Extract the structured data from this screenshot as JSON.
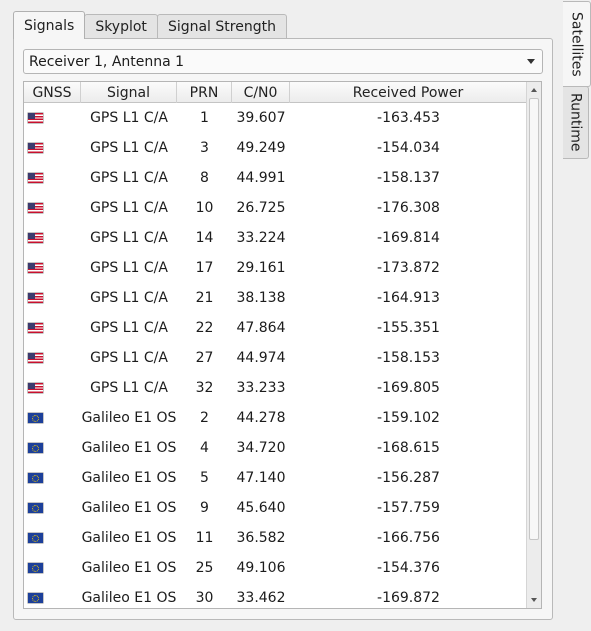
{
  "tabs": [
    "Signals",
    "Skyplot",
    "Signal Strength"
  ],
  "side_tabs": [
    "Satellites",
    "Runtime"
  ],
  "receiver_select": {
    "value": "Receiver 1, Antenna 1"
  },
  "table": {
    "columns": [
      "GNSS",
      "Signal",
      "PRN",
      "C/N0",
      "Received Power"
    ],
    "rows": [
      {
        "gnss": "us-flag-icon",
        "signal": "GPS L1 C/A",
        "prn": "1",
        "cn0": "39.607",
        "power": "-163.453"
      },
      {
        "gnss": "us-flag-icon",
        "signal": "GPS L1 C/A",
        "prn": "3",
        "cn0": "49.249",
        "power": "-154.034"
      },
      {
        "gnss": "us-flag-icon",
        "signal": "GPS L1 C/A",
        "prn": "8",
        "cn0": "44.991",
        "power": "-158.137"
      },
      {
        "gnss": "us-flag-icon",
        "signal": "GPS L1 C/A",
        "prn": "10",
        "cn0": "26.725",
        "power": "-176.308"
      },
      {
        "gnss": "us-flag-icon",
        "signal": "GPS L1 C/A",
        "prn": "14",
        "cn0": "33.224",
        "power": "-169.814"
      },
      {
        "gnss": "us-flag-icon",
        "signal": "GPS L1 C/A",
        "prn": "17",
        "cn0": "29.161",
        "power": "-173.872"
      },
      {
        "gnss": "us-flag-icon",
        "signal": "GPS L1 C/A",
        "prn": "21",
        "cn0": "38.138",
        "power": "-164.913"
      },
      {
        "gnss": "us-flag-icon",
        "signal": "GPS L1 C/A",
        "prn": "22",
        "cn0": "47.864",
        "power": "-155.351"
      },
      {
        "gnss": "us-flag-icon",
        "signal": "GPS L1 C/A",
        "prn": "27",
        "cn0": "44.974",
        "power": "-158.153"
      },
      {
        "gnss": "us-flag-icon",
        "signal": "GPS L1 C/A",
        "prn": "32",
        "cn0": "33.233",
        "power": "-169.805"
      },
      {
        "gnss": "eu-flag-icon",
        "signal": "Galileo E1 OS",
        "prn": "2",
        "cn0": "44.278",
        "power": "-159.102"
      },
      {
        "gnss": "eu-flag-icon",
        "signal": "Galileo E1 OS",
        "prn": "4",
        "cn0": "34.720",
        "power": "-168.615"
      },
      {
        "gnss": "eu-flag-icon",
        "signal": "Galileo E1 OS",
        "prn": "5",
        "cn0": "47.140",
        "power": "-156.287"
      },
      {
        "gnss": "eu-flag-icon",
        "signal": "Galileo E1 OS",
        "prn": "9",
        "cn0": "45.640",
        "power": "-157.759"
      },
      {
        "gnss": "eu-flag-icon",
        "signal": "Galileo E1 OS",
        "prn": "11",
        "cn0": "36.582",
        "power": "-166.756"
      },
      {
        "gnss": "eu-flag-icon",
        "signal": "Galileo E1 OS",
        "prn": "25",
        "cn0": "49.106",
        "power": "-154.376"
      },
      {
        "gnss": "eu-flag-icon",
        "signal": "Galileo E1 OS",
        "prn": "30",
        "cn0": "33.462",
        "power": "-169.872"
      }
    ]
  }
}
